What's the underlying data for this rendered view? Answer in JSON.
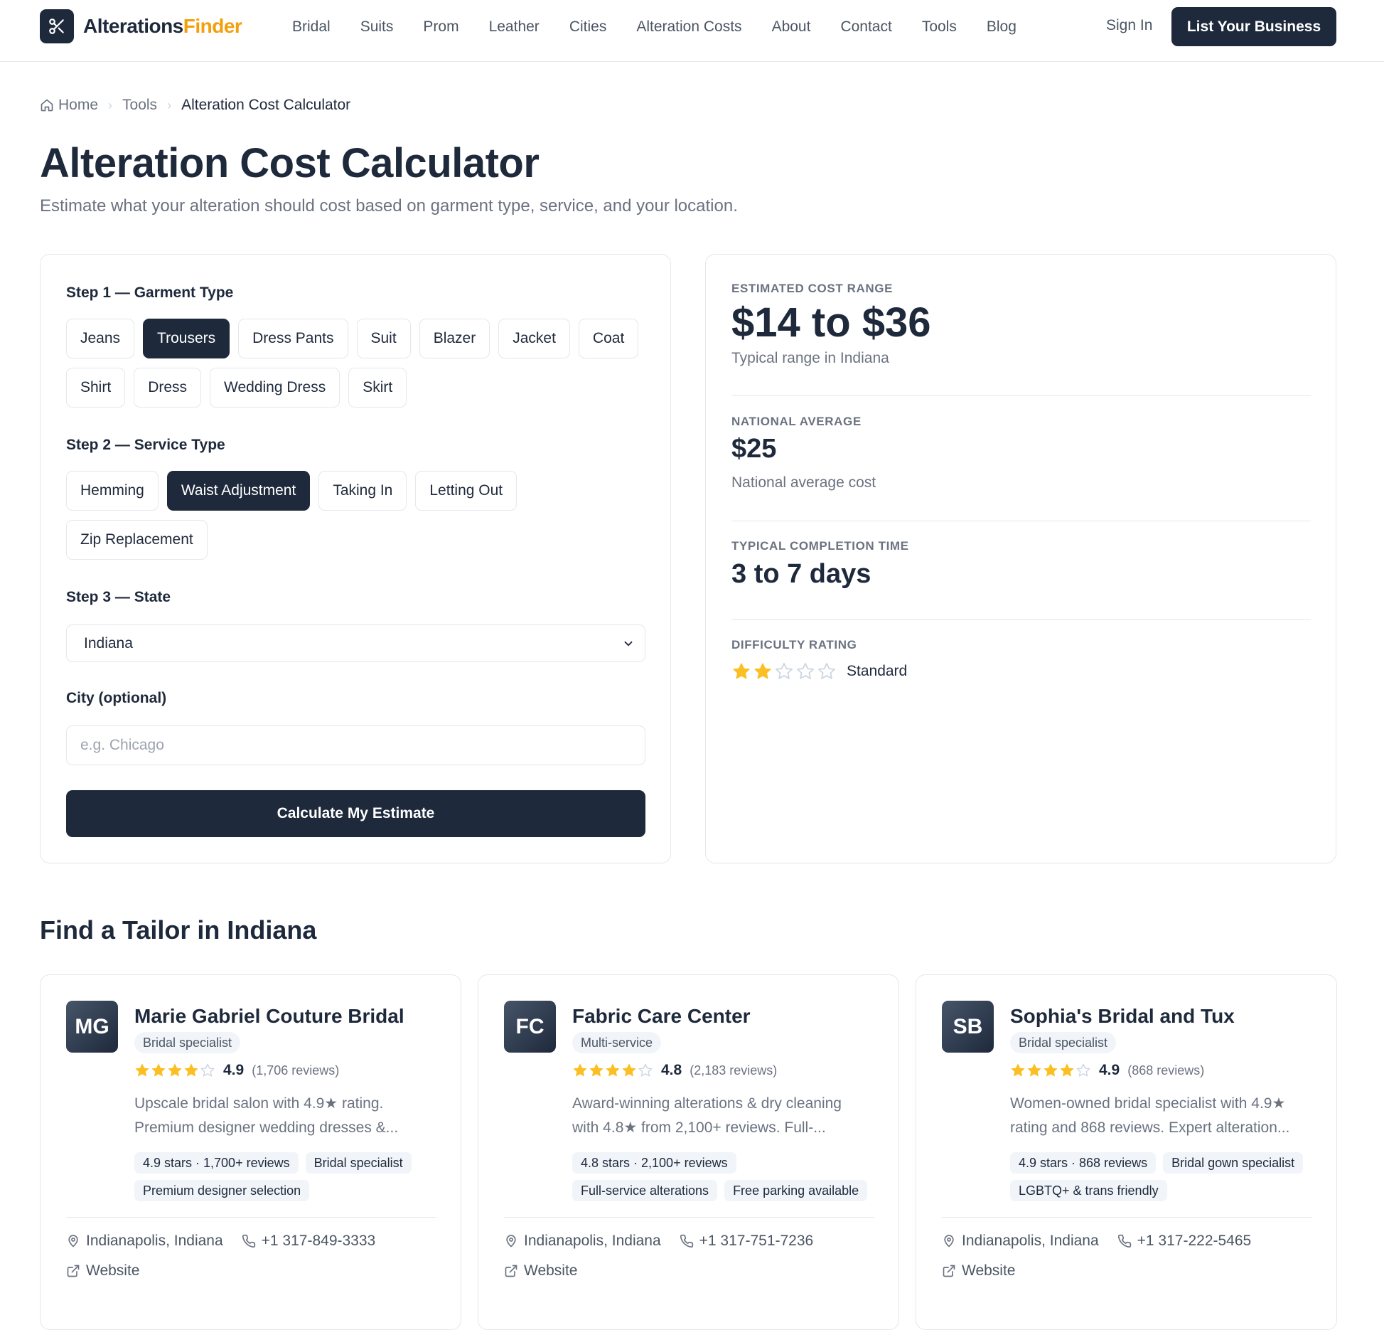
{
  "header": {
    "logo_main": "Alterations",
    "logo_accent": "Finder",
    "nav": [
      "Bridal",
      "Suits",
      "Prom",
      "Leather",
      "Cities",
      "Alteration Costs",
      "About",
      "Contact",
      "Tools",
      "Blog"
    ],
    "sign_in": "Sign In",
    "cta": "List Your Business"
  },
  "breadcrumb": {
    "home": "Home",
    "tools": "Tools",
    "current": "Alteration Cost Calculator"
  },
  "page": {
    "title": "Alteration Cost Calculator",
    "subtitle": "Estimate what your alteration should cost based on garment type, service, and your location."
  },
  "form": {
    "step1_label": "Step 1 — Garment Type",
    "garments": [
      "Jeans",
      "Trousers",
      "Dress Pants",
      "Suit",
      "Blazer",
      "Jacket",
      "Coat",
      "Shirt",
      "Dress",
      "Wedding Dress",
      "Skirt"
    ],
    "selected_garment": "Trousers",
    "step2_label": "Step 2 — Service Type",
    "services": [
      "Hemming",
      "Waist Adjustment",
      "Taking In",
      "Letting Out",
      "Zip Replacement"
    ],
    "selected_service": "Waist Adjustment",
    "step3_label": "Step 3 — State",
    "state_value": "Indiana",
    "city_label": "City (optional)",
    "city_placeholder": "e.g. Chicago",
    "city_value": "",
    "submit": "Calculate My Estimate"
  },
  "results": {
    "range_label": "ESTIMATED COST RANGE",
    "range_value": "$14 to $36",
    "range_note": "Typical range in Indiana",
    "national_label": "NATIONAL AVERAGE",
    "national_value": "$25",
    "national_note": "National average cost",
    "time_label": "TYPICAL COMPLETION TIME",
    "time_value": "3 to 7 days",
    "difficulty_label": "DIFFICULTY RATING",
    "difficulty_stars": 2,
    "difficulty_max": 5,
    "difficulty_text": "Standard"
  },
  "tailors_section": {
    "title": "Find a Tailor in Indiana",
    "tailors": [
      {
        "initials": "MG",
        "name": "Marie Gabriel Couture Bridal",
        "category": "Bridal specialist",
        "rating": "4.9",
        "reviews": "(1,706 reviews)",
        "desc_line1": "Upscale bridal salon with 4.9★ rating.",
        "desc_line2": "Premium designer wedding dresses &...",
        "tags": [
          "4.9 stars · 1,700+ reviews",
          "Bridal specialist",
          "Premium designer selection"
        ],
        "location": "Indianapolis, Indiana",
        "phone": "+1 317-849-3333",
        "website": "Website"
      },
      {
        "initials": "FC",
        "name": "Fabric Care Center",
        "category": "Multi-service",
        "rating": "4.8",
        "reviews": "(2,183 reviews)",
        "desc_line1": "Award-winning alterations & dry cleaning",
        "desc_line2": "with 4.8★ from 2,100+ reviews. Full-...",
        "tags": [
          "4.8 stars · 2,100+ reviews",
          "Full-service alterations",
          "Free parking available"
        ],
        "location": "Indianapolis, Indiana",
        "phone": "+1 317-751-7236",
        "website": "Website"
      },
      {
        "initials": "SB",
        "name": "Sophia's Bridal and Tux",
        "category": "Bridal specialist",
        "rating": "4.9",
        "reviews": "(868 reviews)",
        "desc_line1": "Women-owned bridal specialist with 4.9★",
        "desc_line2": "rating and 868 reviews. Expert alteration...",
        "tags": [
          "4.9 stars · 868 reviews",
          "Bridal gown specialist",
          "LGBTQ+ & trans friendly"
        ],
        "location": "Indianapolis, Indiana",
        "phone": "+1 317-222-5465",
        "website": "Website"
      }
    ]
  },
  "colors": {
    "primary": "#1e293b",
    "accent": "#f59e0b",
    "muted": "#6b7280",
    "border": "#e5e7eb"
  }
}
